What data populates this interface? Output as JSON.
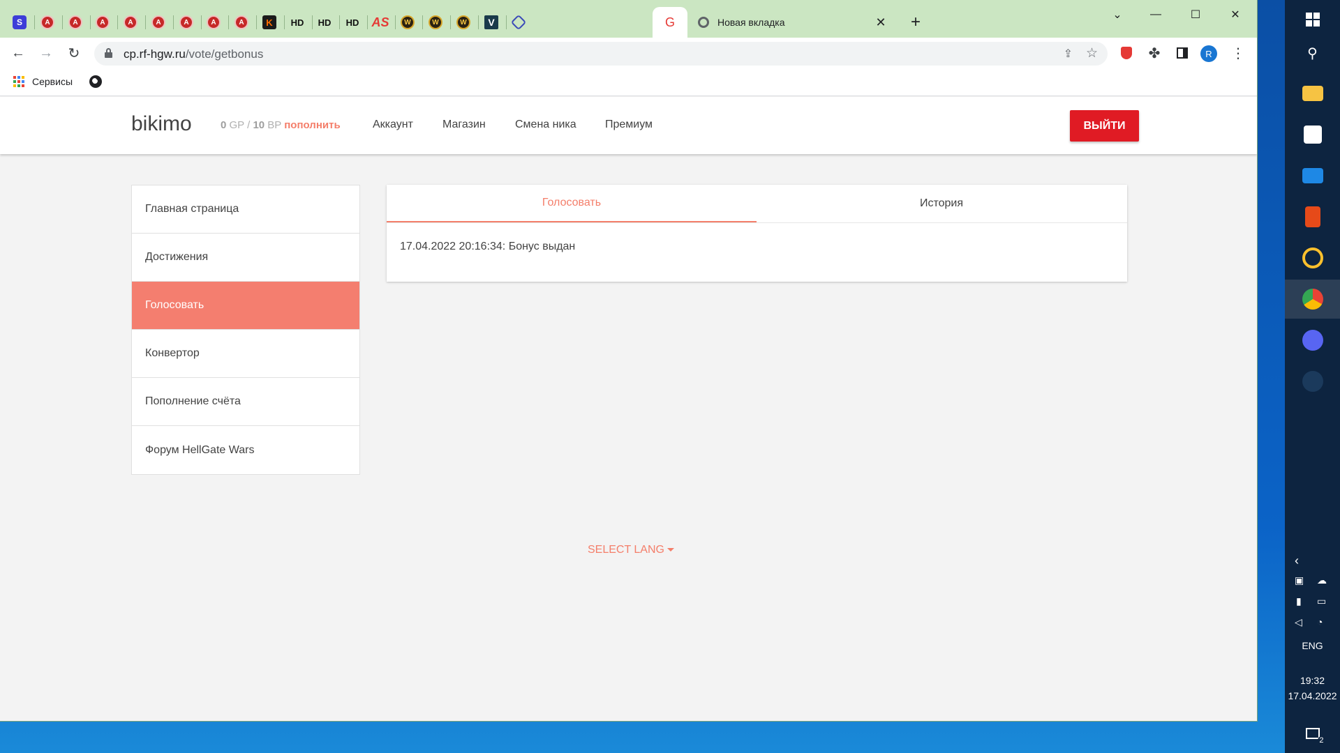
{
  "browser": {
    "tab_title": "Новая вкладка",
    "pinned_tabs": [
      {
        "icon": "s-icon",
        "label": "S"
      },
      {
        "icon": "red-ring-icon",
        "label": "A"
      },
      {
        "icon": "red-ring-icon",
        "label": "A"
      },
      {
        "icon": "red-ring-icon",
        "label": "A"
      },
      {
        "icon": "red-ring-icon",
        "label": "A"
      },
      {
        "icon": "red-ring-icon",
        "label": "A"
      },
      {
        "icon": "red-ring-icon",
        "label": "A"
      },
      {
        "icon": "red-ring-icon",
        "label": "A"
      },
      {
        "icon": "red-ring-icon",
        "label": "A"
      },
      {
        "icon": "k-icon",
        "label": "K"
      },
      {
        "icon": "hd-icon",
        "label": "HD"
      },
      {
        "icon": "hd-icon",
        "label": "HD"
      },
      {
        "icon": "hd-icon",
        "label": "HD"
      },
      {
        "icon": "as-icon",
        "label": "AS"
      },
      {
        "icon": "wow-icon",
        "label": "W"
      },
      {
        "icon": "wow-icon",
        "label": "W"
      },
      {
        "icon": "wow-icon",
        "label": "W"
      },
      {
        "icon": "v-icon",
        "label": "V"
      },
      {
        "icon": "hex-icon",
        "label": ""
      }
    ],
    "active_pinned_label": "G",
    "url_host": "cp.rf-hgw.ru",
    "url_path": "/vote/getbonus",
    "profile_initial": "R",
    "bookmarks": {
      "services_label": "Сервисы"
    }
  },
  "site": {
    "username": "bikimo",
    "balance": {
      "gp_value": "0",
      "gp_unit": "GP",
      "separator": "/",
      "bp_value": "10",
      "bp_unit": "BP",
      "topup_label": "пополнить"
    },
    "nav": [
      "Аккаунт",
      "Магазин",
      "Смена ника",
      "Премиум"
    ],
    "logout_label": "ВЫЙТИ",
    "sidebar": [
      {
        "label": "Главная страница",
        "active": false
      },
      {
        "label": "Достижения",
        "active": false
      },
      {
        "label": "Голосовать",
        "active": true
      },
      {
        "label": "Конвертор",
        "active": false
      },
      {
        "label": "Пополнение счёта",
        "active": false
      },
      {
        "label": "Форум HellGate Wars",
        "active": false
      }
    ],
    "tabs": {
      "vote": "Голосовать",
      "history": "История"
    },
    "vote_log": "17.04.2022 20:16:34: Бонус выдан",
    "select_lang": "SELECT LANG",
    "accent_color": "#f47e6a",
    "logout_color": "#e01b24"
  },
  "taskbar": {
    "lang": "ENG",
    "time": "19:32",
    "date": "17.04.2022",
    "notifications_count": "2",
    "icons": [
      "windows-icon",
      "search-icon",
      "file-explorer-icon",
      "store-icon",
      "mail-icon",
      "office-icon",
      "music-icon",
      "chrome-icon",
      "discord-icon",
      "steam-icon"
    ]
  }
}
